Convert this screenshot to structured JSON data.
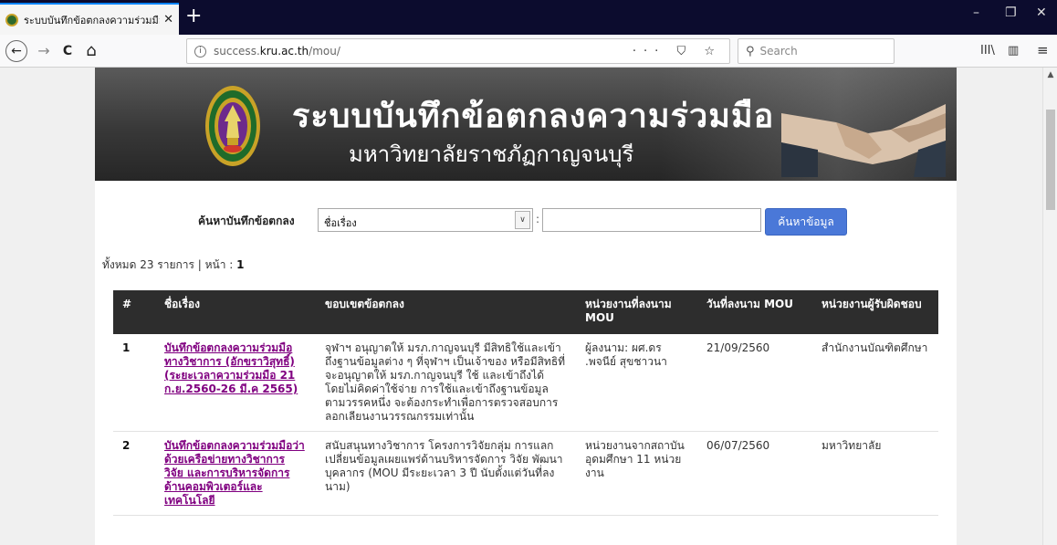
{
  "browser": {
    "tab_title": "ระบบบันทึกข้อตกลงความร่วมมือ",
    "new_tab": "+",
    "tab_close": "✕",
    "url_prefix": "success.",
    "url_host": "kru.ac.th",
    "url_path": "/mou/",
    "url_actions": "··· ⛉ ☆",
    "search_placeholder": "Search",
    "win_minimize": "–",
    "win_restore": "❐",
    "win_close": "✕",
    "nav_back": "←",
    "nav_forward": "→",
    "nav_reload": "C",
    "nav_home": "⌂",
    "tool_library": "III\\",
    "tool_sidebar": "▥",
    "tool_menu": "≡"
  },
  "banner": {
    "title": "ระบบบันทึกข้อตกลงความร่วมมือ",
    "subtitle": "มหาวิทยาลัยราชภัฏกาญจนบุรี"
  },
  "search": {
    "label": "ค้นหาบันทึกข้อตกลง",
    "field_selected": "ชื่อเรื่อง",
    "colon": ":",
    "keyword_value": "",
    "button_label": "ค้นหาข้อมูล"
  },
  "summary": {
    "prefix": "ทั้งหมด 23 รายการ | หน้า : ",
    "page": "1"
  },
  "table": {
    "headers": [
      "#",
      "ชื่อเรื่อง",
      "ขอบเขตข้อตกลง",
      "หน่วยงานที่ลงนาม MOU",
      "วันที่ลงนาม MOU",
      "หน่วยงานผู้รับผิดชอบ"
    ],
    "rows": [
      {
        "num": "1",
        "title": "บันทึกข้อตกลงความร่วมมือทางวิชาการ (อักขราวิสุทธิ์) (ระยะเวลาความร่วมมือ 21 ก.ย.2560-26 มี.ค 2565)",
        "scope": "จุฬาฯ อนุญาตให้ มรภ.กาญจนบุรี มีสิทธิใช้และเข้าถึงฐานข้อมูลต่าง ๆ ที่จุฬาฯ เป็นเจ้าของ หรือมีสิทธิที่จะอนุญาตให้ มรภ.กาญจนบุรี ใช้ และเข้าถึงได้ โดยไม่คิดค่าใช้จ่าย การใช้และเข้าถึงฐานข้อมูลตามวรรคหนึ่ง จะต้องกระทำเพื่อการตรวจสอบการลอกเลียนงานวรรณกรรมเท่านั้น",
        "signatory": "ผู้ลงนาม: ผศ.ดร .พจนีย์ สุขชาวนา",
        "date": "21/09/2560",
        "owner": "สำนักงานบัณฑิตศึกษา"
      },
      {
        "num": "2",
        "title": "บันทึกข้อตกลงความร่วมมือว่าด้วยเครือข่ายทางวิชาการ วิจัย และการบริหารจัดการ ด้านคอมพิวเตอร์และเทคโนโลยี",
        "scope": "สนับสนุนทางวิชาการ โครงการวิจัยกลุ่ม การแลกเปลี่ยนข้อมูลเผยแพร่ด้านบริหารจัดการ วิจัย พัฒนาบุคลากร (MOU มีระยะเวลา 3 ปี นับตั้งแต่วันที่ลงนาม)",
        "signatory": "หน่วยงานจากสถาบันอุดมศึกษา 11 หน่วยงาน",
        "date": "06/07/2560",
        "owner": "มหาวิทยาลัย"
      }
    ]
  }
}
